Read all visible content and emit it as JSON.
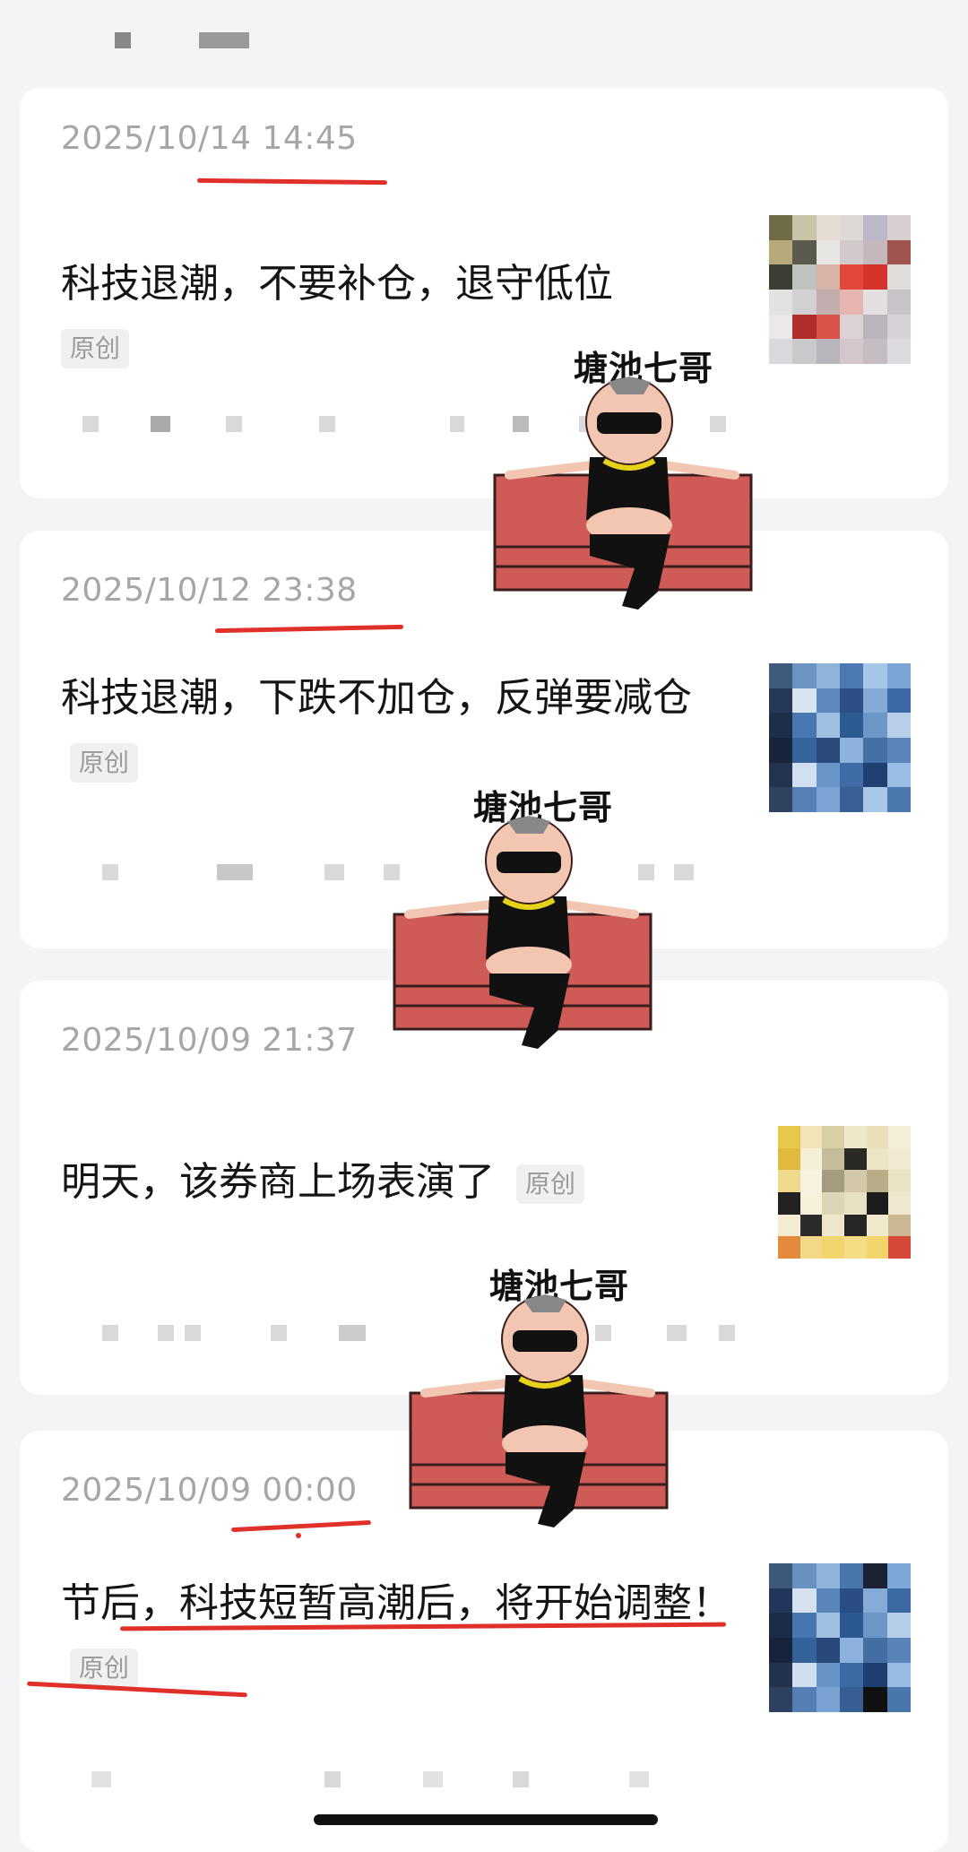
{
  "posts": [
    {
      "date": "2025/10/14 14:45",
      "title": "科技退潮，不要补仓，退守低位",
      "tag": "原创"
    },
    {
      "date": "2025/10/12 23:38",
      "title": "科技退潮，下跌不加仓，反弹要减仓",
      "tag": "原创"
    },
    {
      "date": "2025/10/09 21:37",
      "title": "明天，该券商上场表演了",
      "tag": "原创"
    },
    {
      "date": "2025/10/09 00:00",
      "title": "节后，科技短暂高潮后，将开始调整！",
      "tag": "原创"
    }
  ],
  "sticker": {
    "caption": "塘池七哥",
    "icon": "cartoon-man-on-sofa"
  },
  "colors": {
    "annotation": "#e0302a",
    "sofa": "#cf5b57",
    "background": "#f3f4f6"
  }
}
